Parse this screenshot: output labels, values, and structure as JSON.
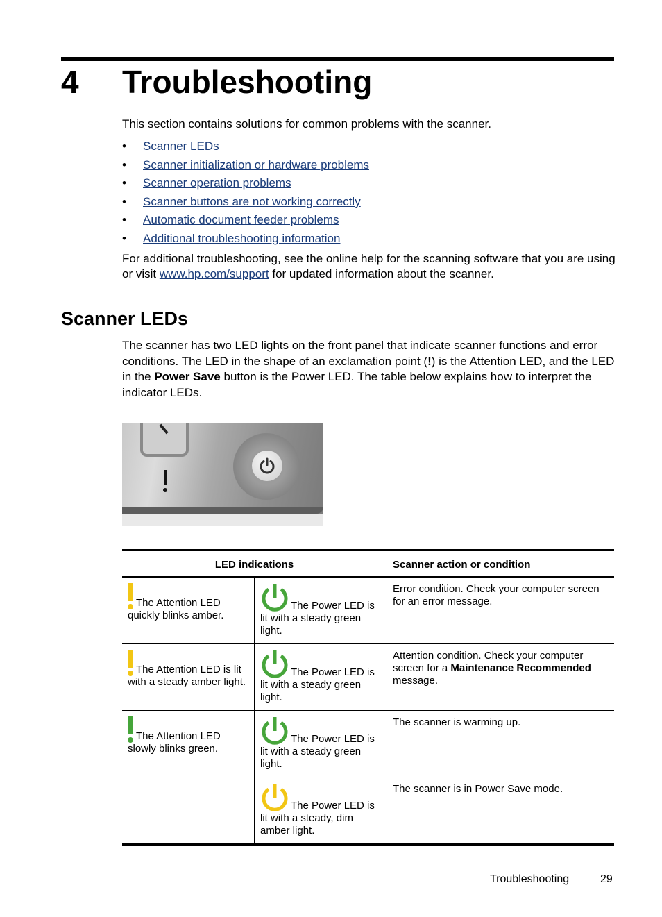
{
  "chapter": {
    "number": "4",
    "title": "Troubleshooting"
  },
  "intro": "This section contains solutions for common problems with the scanner.",
  "bullet_glyph": "•",
  "toc_links": [
    "Scanner LEDs",
    "Scanner initialization or hardware problems",
    "Scanner operation problems",
    "Scanner buttons are not working correctly",
    "Automatic document feeder problems",
    "Additional troubleshooting information"
  ],
  "additional": {
    "before": "For additional troubleshooting, see the online help for the scanning software that you are using or visit ",
    "link": "www.hp.com/support",
    "after": " for updated information about the scanner."
  },
  "section": {
    "heading": "Scanner LEDs",
    "p1": "The scanner has two LED lights on the front panel that indicate scanner functions and error conditions. The LED in the shape of an exclamation point (",
    "p1_bold": "!",
    "p2": ") is the Attention LED, and the LED in the ",
    "p2_bold": "Power Save",
    "p3": " button is the Power LED. The table below explains how to interpret the indicator LEDs."
  },
  "colors": {
    "amber": "#f2c614",
    "green": "#46a53a",
    "link": "#1a3c7a"
  },
  "table": {
    "headers": [
      "LED indications",
      "Scanner action or condition"
    ],
    "rows": [
      {
        "attention": "The Attention LED quickly blinks amber.",
        "attention_color": "amber",
        "power": "The Power LED is lit with a steady green light.",
        "power_color": "green",
        "condition": "Error condition. Check your computer screen for an error message.",
        "condition_bold": "",
        "condition_after": ""
      },
      {
        "attention": "The Attention LED is lit with a steady amber light.",
        "attention_color": "amber",
        "power": "The Power LED is lit with a steady green light.",
        "power_color": "green",
        "condition": "Attention condition. Check your computer screen for a ",
        "condition_bold": "Maintenance Recommended",
        "condition_after": " message."
      },
      {
        "attention": "The Attention LED slowly blinks green.",
        "attention_color": "green",
        "power": "The Power LED is lit with a steady green light.",
        "power_color": "green",
        "condition": "The scanner is warming up.",
        "condition_bold": "",
        "condition_after": ""
      },
      {
        "attention": "",
        "attention_color": "",
        "power": "The Power LED is lit with a steady, dim amber light.",
        "power_color": "amber",
        "condition": "The scanner is in Power Save mode.",
        "condition_bold": "",
        "condition_after": ""
      }
    ]
  },
  "footer": {
    "label": "Troubleshooting",
    "page": "29"
  }
}
